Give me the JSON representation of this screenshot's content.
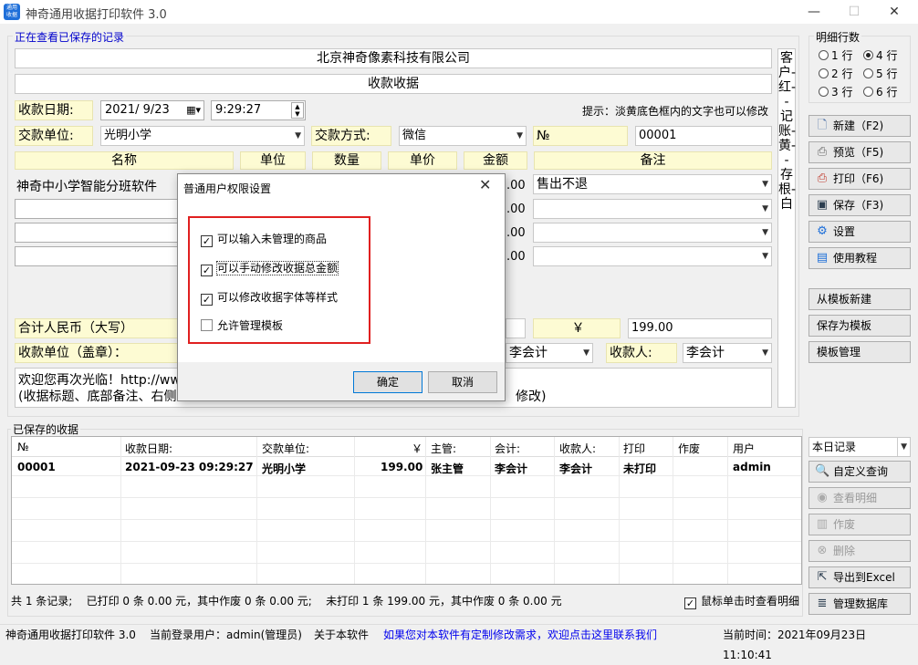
{
  "window": {
    "title": "神奇通用收据打印软件 3.0",
    "minimize": "—",
    "maximize": "☐",
    "close": "✕"
  },
  "viewing_label": "正在查看已保存的记录",
  "company": "北京神奇像素科技有限公司",
  "receipt_title": "收款收据",
  "date_label": "收款日期:",
  "date_value": "2021/ 9/23",
  "time_value": "9:29:27",
  "hint": "提示：淡黄底色框内的文字也可以修改",
  "payer_label": "交款单位:",
  "payer_value": "光明小学",
  "method_label": "交款方式:",
  "method_value": "微信",
  "no_label": "№",
  "no_value": "00001",
  "columns": {
    "name": "名称",
    "unit": "单位",
    "qty": "数量",
    "price": "单价",
    "amount": "金额",
    "remark": "备注"
  },
  "row1": {
    "name": "神奇中小学智能分班软件",
    "amount_tail": ".00",
    "remark": "售出不退"
  },
  "row_tails": [
    ".00",
    ".00",
    ".00"
  ],
  "total_label": "合计人民币（大写）",
  "currency_symbol": "￥",
  "total_value": "199.00",
  "seal_label": "收款单位（盖章）：",
  "accountant_value": "李会计",
  "receiver_label": "收款人:",
  "receiver_value": "李会计",
  "footer_line1": "欢迎您再次光临！http://ww",
  "footer_line2": "(收据标题、底部备注、右侧",
  "footer_line2_tail": "修改)",
  "side_text": "客户-红--记账-黄--存根-白",
  "rows_group": {
    "title": "明细行数",
    "options": [
      "1 行",
      "2 行",
      "3 行",
      "4 行",
      "5 行",
      "6 行"
    ]
  },
  "buttons": {
    "new": "新建（F2)",
    "preview": "预览（F5)",
    "print": "打印（F6)",
    "save": "保存（F3)",
    "settings": "设置",
    "tutorial": "使用教程",
    "from_template": "从模板新建",
    "save_template": "保存为模板",
    "manage_template": "模板管理",
    "custom_query": "自定义查询",
    "view_detail": "查看明细",
    "void": "作废",
    "delete": "删除",
    "export_excel": "导出到Excel",
    "manage_db": "管理数据库"
  },
  "saved_title": "已保存的收据",
  "filter_value": "本日记录",
  "table": {
    "headers": [
      "№",
      "收款日期:",
      "交款单位:",
      "￥",
      "主管:",
      "会计:",
      "收款人:",
      "打印",
      "作废",
      "用户"
    ],
    "rows": [
      [
        "00001",
        "2021-09-23 09:29:27",
        "光明小学",
        "199.00",
        "张主管",
        "李会计",
        "李会计",
        "未打印",
        "",
        "admin"
      ]
    ]
  },
  "summary": "共 1 条记录;    已打印 0 条 0.00 元，其中作废 0 条 0.00 元;    未打印 1 条 199.00 元，其中作废 0 条 0.00 元",
  "click_detail": "鼠标单击时查看明细",
  "status": {
    "app": "神奇通用收据打印软件 3.0",
    "user": "当前登录用户：admin(管理员)",
    "about": "关于本软件",
    "link": "如果您对本软件有定制修改需求，欢迎点击这里联系我们",
    "time": "当前时间：2021年09月23日 11:10:41"
  },
  "dialog": {
    "title": "普通用户权限设置",
    "options": [
      "可以输入未管理的商品",
      "可以手动修改收据总金额",
      "可以修改收据字体等样式",
      "允许管理模板"
    ],
    "checked": [
      "✓",
      "✓",
      "✓",
      ""
    ],
    "ok": "确定",
    "cancel": "取消"
  }
}
